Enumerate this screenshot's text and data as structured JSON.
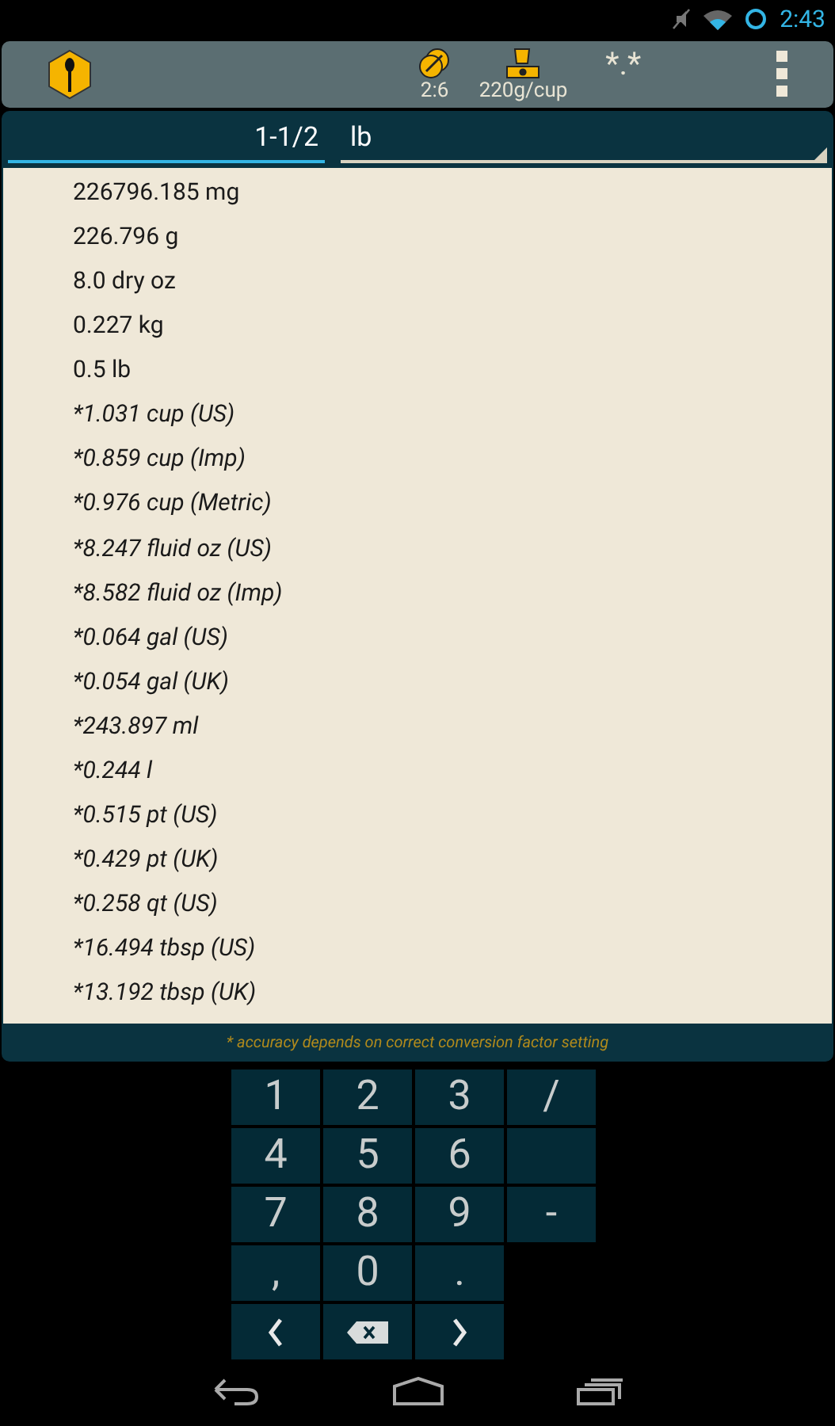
{
  "status_bar": {
    "time": "2:43"
  },
  "toolbar": {
    "ratio": "2:6",
    "density": "220g/cup",
    "precision": "*.*"
  },
  "input": {
    "value": "1-1/2",
    "unit": "lb"
  },
  "results": [
    {
      "text": "226796.185 mg",
      "kind": "exact"
    },
    {
      "text": "226.796 g",
      "kind": "exact"
    },
    {
      "text": "8.0 dry oz",
      "kind": "exact"
    },
    {
      "text": "0.227 kg",
      "kind": "exact"
    },
    {
      "text": "0.5 lb",
      "kind": "exact"
    },
    {
      "text": "*1.031 cup (US)",
      "kind": "approx"
    },
    {
      "text": "*0.859 cup (Imp)",
      "kind": "approx"
    },
    {
      "text": "*0.976 cup (Metric)",
      "kind": "approx"
    },
    {
      "text": "*8.247 fluid oz (US)",
      "kind": "approx"
    },
    {
      "text": "*8.582 fluid oz (Imp)",
      "kind": "approx"
    },
    {
      "text": "*0.064 gal (US)",
      "kind": "approx"
    },
    {
      "text": "*0.054 gal (UK)",
      "kind": "approx"
    },
    {
      "text": "*243.897 ml",
      "kind": "approx"
    },
    {
      "text": "*0.244 l",
      "kind": "approx"
    },
    {
      "text": "*0.515 pt (US)",
      "kind": "approx"
    },
    {
      "text": "*0.429 pt (UK)",
      "kind": "approx"
    },
    {
      "text": "*0.258 qt (US)",
      "kind": "approx"
    },
    {
      "text": "*16.494 tbsp (US)",
      "kind": "approx"
    },
    {
      "text": "*13.192 tbsp (UK)",
      "kind": "approx"
    }
  ],
  "footnote": "* accuracy depends on correct conversion factor setting",
  "keypad": [
    [
      {
        "kind": "char",
        "label": "1"
      },
      {
        "kind": "char",
        "label": "2"
      },
      {
        "kind": "char",
        "label": "3"
      },
      {
        "kind": "char",
        "label": "/"
      }
    ],
    [
      {
        "kind": "char",
        "label": "4"
      },
      {
        "kind": "char",
        "label": "5"
      },
      {
        "kind": "char",
        "label": "6"
      },
      {
        "kind": "blank"
      }
    ],
    [
      {
        "kind": "char",
        "label": "7"
      },
      {
        "kind": "char",
        "label": "8"
      },
      {
        "kind": "char",
        "label": "9"
      },
      {
        "kind": "char",
        "label": "-"
      }
    ],
    [
      {
        "kind": "char",
        "label": ","
      },
      {
        "kind": "char",
        "label": "0"
      },
      {
        "kind": "char",
        "label": "."
      }
    ],
    [
      {
        "kind": "left"
      },
      {
        "kind": "backspace"
      },
      {
        "kind": "right"
      }
    ]
  ]
}
